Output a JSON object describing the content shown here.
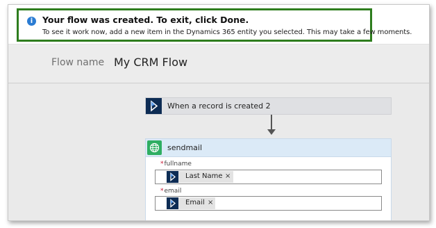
{
  "notification": {
    "icon": "info-icon",
    "icon_glyph": "i",
    "title": "Your flow was created. To exit, click Done.",
    "message": "To see it work now, add a new item in the Dynamics 365 entity you selected. This may take a few moments."
  },
  "flow": {
    "name_label": "Flow name",
    "name_value": "My CRM Flow"
  },
  "trigger": {
    "icon": "dynamics-365-icon",
    "label": "When a record is created 2"
  },
  "action": {
    "icon": "globe-icon",
    "title": "sendmail",
    "fields": [
      {
        "required_mark": "*",
        "label": "fullname",
        "token": "Last Name",
        "remove": "×"
      },
      {
        "required_mark": "*",
        "label": "email",
        "token": "Email",
        "remove": "×"
      }
    ]
  },
  "colors": {
    "notification_border": "#2e7d1e",
    "info_icon": "#2b7cd3",
    "dynamics_brand": "#0d2c54",
    "action_header": "#dbeaf7",
    "http_icon": "#2fae62",
    "required": "#c8102e"
  }
}
